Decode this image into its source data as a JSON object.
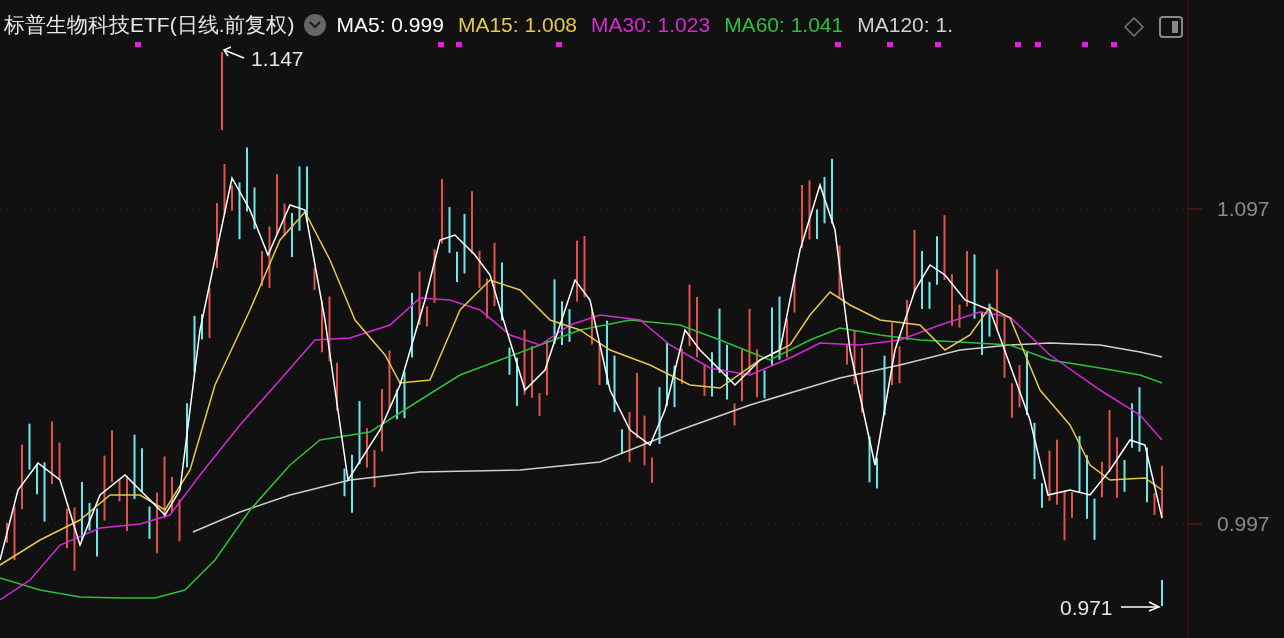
{
  "title": "标普生物科技ETF(日线.前复权)",
  "indicators": [
    {
      "label": "MA5:",
      "value": "0.999",
      "color": "#ffffff"
    },
    {
      "label": "MA15:",
      "value": "1.008",
      "color": "#e6c84a"
    },
    {
      "label": "MA30:",
      "value": "1.023",
      "color": "#d42ad4"
    },
    {
      "label": "MA60:",
      "value": "1.041",
      "color": "#2fbf3c"
    },
    {
      "label": "MA120:",
      "value": "1.",
      "color": "#d0d0d0"
    }
  ],
  "price_axis": [
    "1.097",
    "0.997"
  ],
  "high_label": "1.147",
  "low_label": "0.971"
}
